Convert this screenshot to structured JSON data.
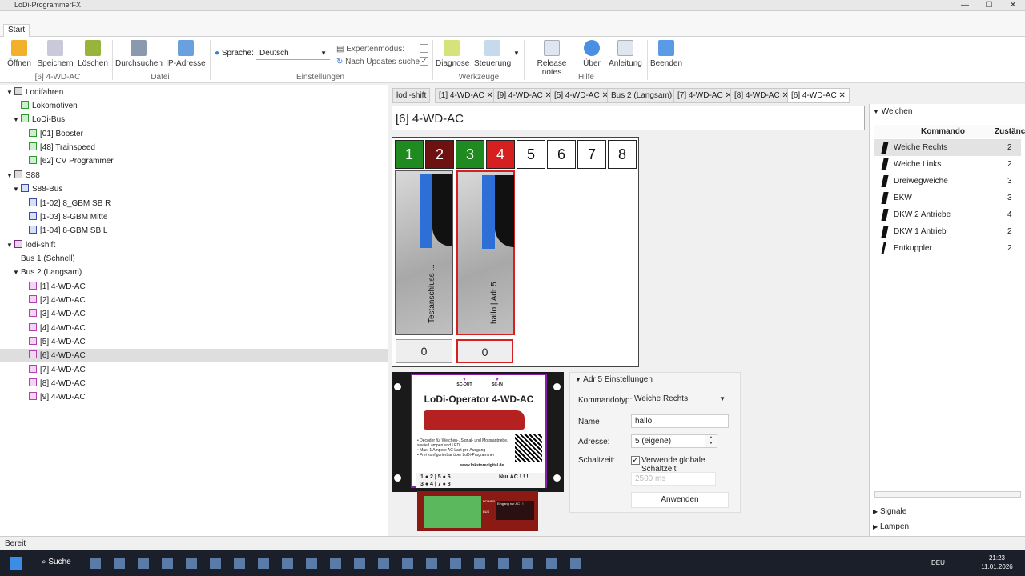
{
  "app": {
    "title": "LoDi-ProgrammerFX",
    "min": "—",
    "max": "☐",
    "close": "✕"
  },
  "ribbon": {
    "tab": "Start",
    "buttons": {
      "open": "Öffnen",
      "save": "Speichern",
      "delete": "Löschen",
      "search": "Durchsuchen",
      "ip": "IP-Adresse",
      "diag": "Diagnose",
      "control": "Steuerung",
      "release": "Release notes",
      "about": "Über",
      "manual": "Anleitung",
      "quit": "Beenden"
    },
    "lang_label": "Sprache:",
    "lang_value": "Deutsch",
    "expert": "Expertenmodus:",
    "updates": "Nach Updates suchen:",
    "groups": {
      "device": "[6] 4-WD-AC",
      "file": "Datei",
      "settings": "Einstellungen",
      "tools": "Werkzeuge",
      "help": "Hilfe"
    }
  },
  "tree": [
    "Lodifahren",
    "Lokomotiven",
    "LoDi-Bus",
    "[01] Booster",
    "[48] Trainspeed",
    "[62] CV Programmer",
    "S88",
    "S88-Bus",
    "[1-02] 8_GBM SB R",
    "[1-03] 8-GBM Mitte",
    "[1-04] 8-GBM SB L",
    "lodi-shift",
    "Bus 1 (Schnell)",
    "Bus 2 (Langsam)",
    "[1] 4-WD-AC",
    "[2] 4-WD-AC",
    "[3] 4-WD-AC",
    "[4] 4-WD-AC",
    "[5] 4-WD-AC",
    "[6] 4-WD-AC",
    "[7] 4-WD-AC",
    "[8] 4-WD-AC",
    "[9] 4-WD-AC"
  ],
  "doc_tabs": [
    "lodi-shift",
    "[1] 4-WD-AC",
    "[9] 4-WD-AC",
    "[5] 4-WD-AC",
    "Bus 2 (Langsam)",
    "[7] 4-WD-AC",
    "[8] 4-WD-AC",
    "[6] 4-WD-AC"
  ],
  "doc_title": "[6] 4-WD-AC",
  "slots": [
    "1",
    "2",
    "3",
    "4",
    "5",
    "6",
    "7",
    "8"
  ],
  "slot_colors": [
    "#1f8a1f",
    "#6e1111",
    "#1f8a1f",
    "#d61f1f",
    "#ffffff",
    "#ffffff",
    "#ffffff",
    "#ffffff"
  ],
  "cards": [
    {
      "label": "Testanschluss ...",
      "count": "0"
    },
    {
      "label": "hallo | Adr 5",
      "count": "0"
    }
  ],
  "device": {
    "sc_out": "SC-OUT",
    "sc_in": "SC-IN",
    "title": "LoDi-Operator  4-WD-AC",
    "bullets": "• Decoder für Weichen-, Signal- und Motorantriebe, sowie Lampen und LED\n• Max. 1 Ampere AC Last pro Ausgang\n• Frei konfigurierbar über LoDi-Programmer",
    "url": "www.lokstoredigital.de",
    "row1": "1 ● 2 | 5 ● 6",
    "row2": "3 ● 4 | 7 ● 8",
    "ac": "Nur AC ! ! !",
    "power": "POWER",
    "bus": "BUS",
    "eingang": "Eingang nur AC ! ! !"
  },
  "settings": {
    "header": "Adr 5 Einstellungen",
    "typ_label": "Kommandotyp:",
    "typ_value": "Weiche Rechts",
    "name_label": "Name",
    "name_value": "hallo",
    "addr_label": "Adresse:",
    "addr_value": "5 (eigene)",
    "time_label": "Schaltzeit:",
    "time_check": "Verwende globale Schaltzeit",
    "time_value": "2500 ms",
    "apply": "Anwenden"
  },
  "right": {
    "section": "Weichen",
    "col1": "Kommando",
    "col2": "Zustänc",
    "rows": [
      {
        "name": "Weiche Rechts",
        "n": "2"
      },
      {
        "name": "Weiche Links",
        "n": "2"
      },
      {
        "name": "Dreiwegweiche",
        "n": "3"
      },
      {
        "name": "EKW",
        "n": "3"
      },
      {
        "name": "DKW 2 Antriebe",
        "n": "4"
      },
      {
        "name": "DKW 1 Antrieb",
        "n": "2"
      },
      {
        "name": "Entkuppler",
        "n": "2"
      }
    ],
    "signale": "Signale",
    "lampen": "Lampen"
  },
  "status": "Bereit",
  "taskbar": {
    "search": "Suche",
    "lang": "DEU",
    "time": "21:23",
    "date": "11.01.2026"
  }
}
